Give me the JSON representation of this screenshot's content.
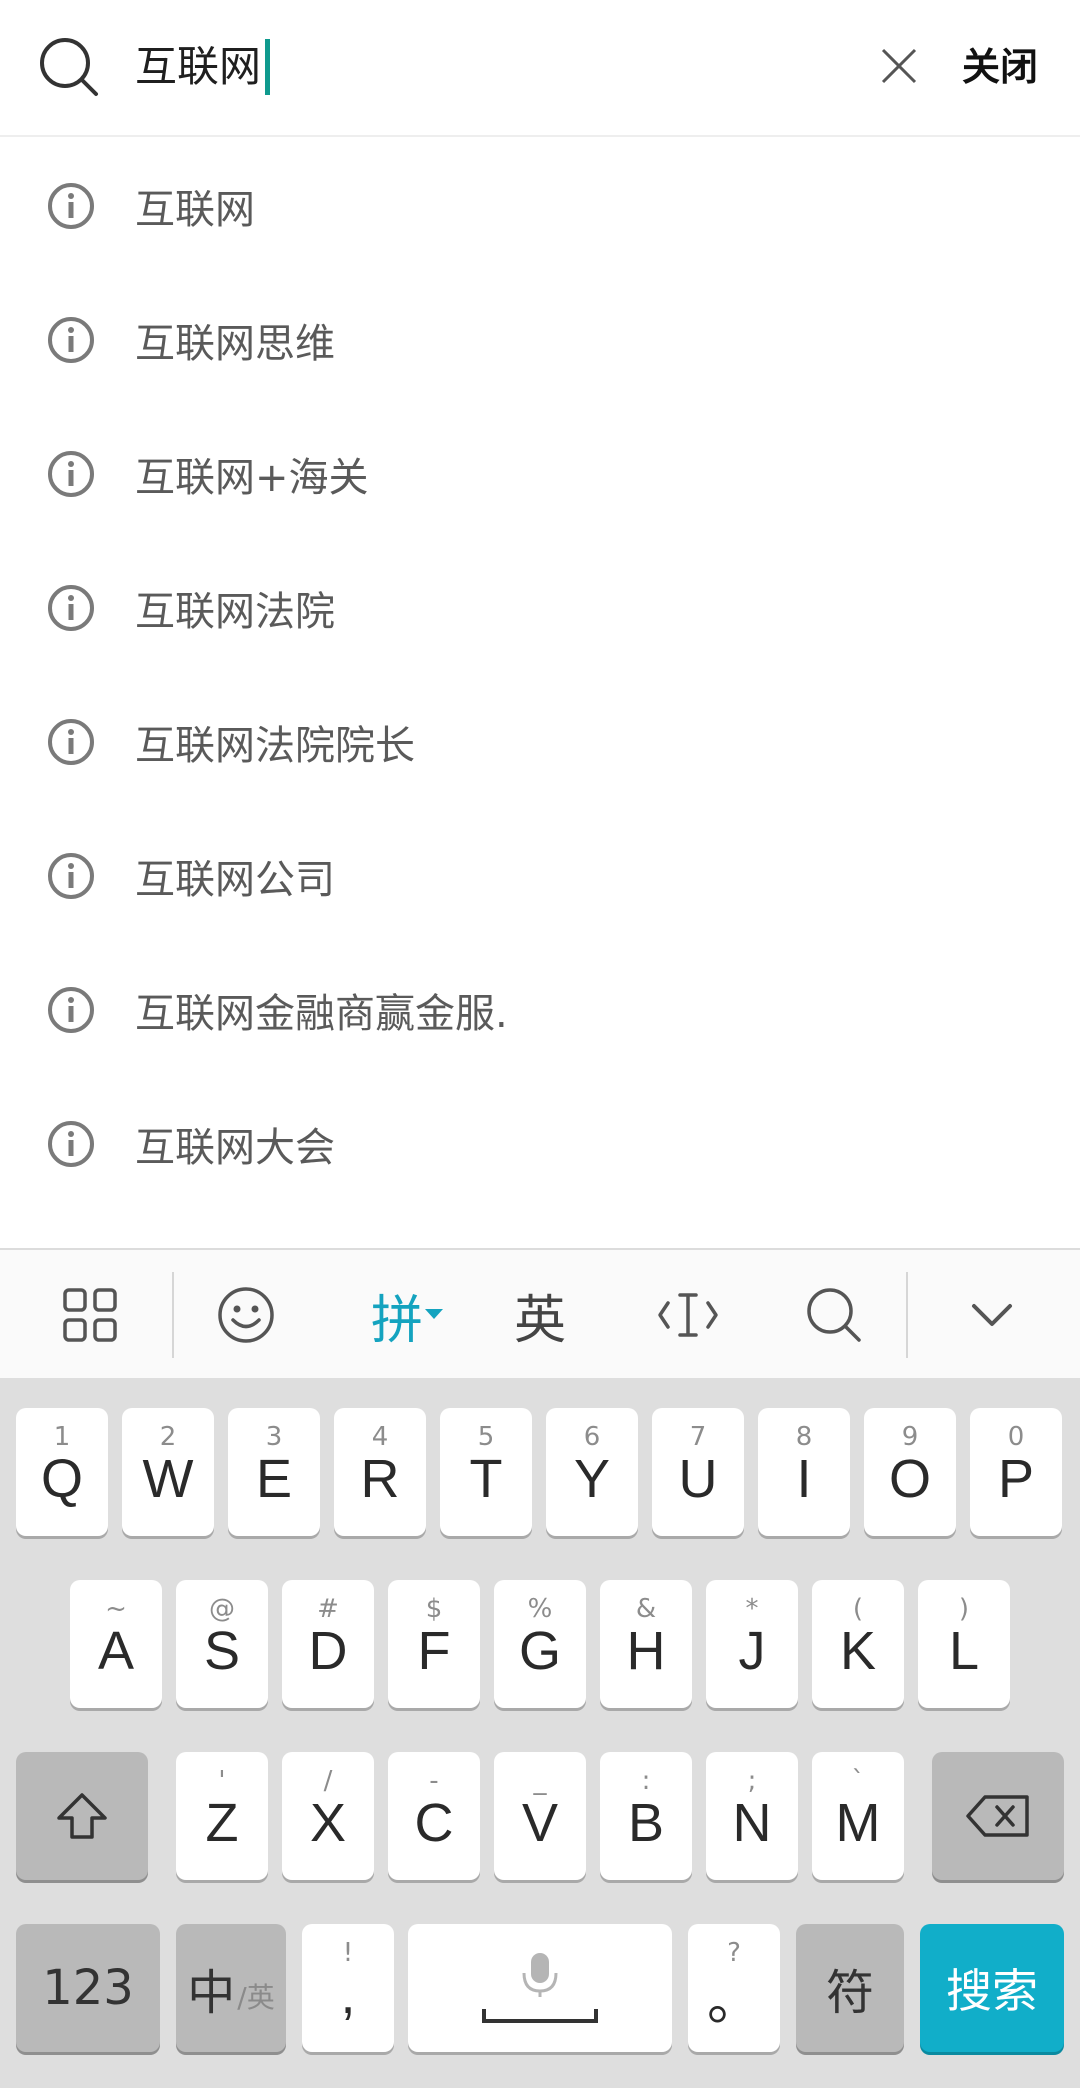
{
  "search": {
    "query": "互联网",
    "close_label": "关闭"
  },
  "suggestions": [
    {
      "label": "互联网"
    },
    {
      "label": "互联网思维"
    },
    {
      "label": "互联网+海关"
    },
    {
      "label": "互联网法院"
    },
    {
      "label": "互联网法院院长"
    },
    {
      "label": "互联网公司"
    },
    {
      "label": "互联网金融商赢金服."
    },
    {
      "label": "互联网大会"
    }
  ],
  "toolbar": {
    "pinyin_label": "拼",
    "english_label": "英",
    "active_color": "#14a3bf"
  },
  "keyboard": {
    "row1": [
      {
        "key": "Q",
        "hint": "1"
      },
      {
        "key": "W",
        "hint": "2"
      },
      {
        "key": "E",
        "hint": "3"
      },
      {
        "key": "R",
        "hint": "4"
      },
      {
        "key": "T",
        "hint": "5"
      },
      {
        "key": "Y",
        "hint": "6"
      },
      {
        "key": "U",
        "hint": "7"
      },
      {
        "key": "I",
        "hint": "8"
      },
      {
        "key": "O",
        "hint": "9"
      },
      {
        "key": "P",
        "hint": "0"
      }
    ],
    "row2": [
      {
        "key": "A",
        "hint": "~"
      },
      {
        "key": "S",
        "hint": "@"
      },
      {
        "key": "D",
        "hint": "#"
      },
      {
        "key": "F",
        "hint": "$"
      },
      {
        "key": "G",
        "hint": "%"
      },
      {
        "key": "H",
        "hint": "&"
      },
      {
        "key": "J",
        "hint": "*"
      },
      {
        "key": "K",
        "hint": "("
      },
      {
        "key": "L",
        "hint": ")"
      }
    ],
    "row3": [
      {
        "key": "Z",
        "hint": "'"
      },
      {
        "key": "X",
        "hint": "/"
      },
      {
        "key": "C",
        "hint": "-"
      },
      {
        "key": "V",
        "hint": "_"
      },
      {
        "key": "B",
        "hint": ":"
      },
      {
        "key": "N",
        "hint": ";"
      },
      {
        "key": "M",
        "hint": "`"
      }
    ],
    "num_label": "123",
    "lang_main": "中",
    "lang_sub": "/英",
    "comma_key": ",",
    "comma_hint": "!",
    "period_key": "。",
    "period_hint": "?",
    "symbol_label": "符",
    "search_label": "搜索",
    "accent_color": "#11aec9"
  }
}
